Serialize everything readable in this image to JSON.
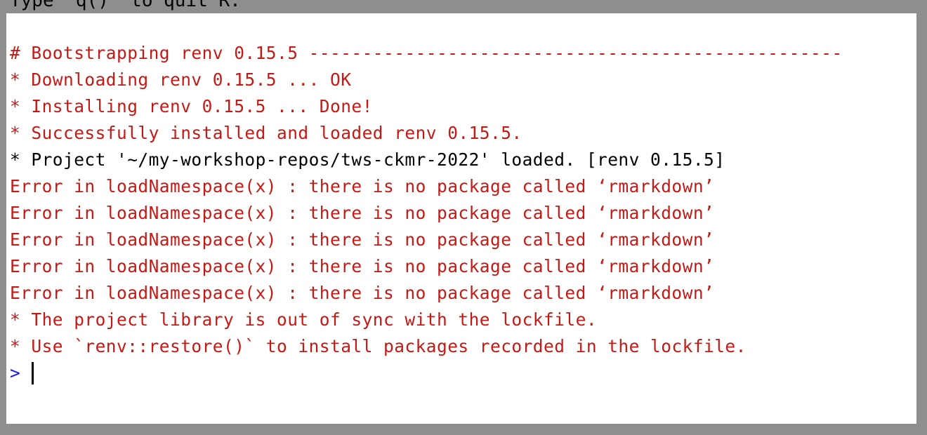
{
  "top_cutoff_text": "Type 'q()' to quit R.",
  "console": {
    "lines": [
      {
        "text": "# Bootstrapping renv 0.15.5 --------------------------------------------------",
        "color": "#c41a16"
      },
      {
        "text": "* Downloading renv 0.15.5 ... OK",
        "color": "#c41a16"
      },
      {
        "text": "* Installing renv 0.15.5 ... Done!",
        "color": "#c41a16"
      },
      {
        "text": "* Successfully installed and loaded renv 0.15.5.",
        "color": "#c41a16"
      },
      {
        "text": "* Project '~/my-workshop-repos/tws-ckmr-2022' loaded. [renv 0.15.5]",
        "color": "#000000"
      },
      {
        "text": "Error in loadNamespace(x) : there is no package called ‘rmarkdown’",
        "color": "#c41a16"
      },
      {
        "text": "Error in loadNamespace(x) : there is no package called ‘rmarkdown’",
        "color": "#c41a16"
      },
      {
        "text": "Error in loadNamespace(x) : there is no package called ‘rmarkdown’",
        "color": "#c41a16"
      },
      {
        "text": "Error in loadNamespace(x) : there is no package called ‘rmarkdown’",
        "color": "#c41a16"
      },
      {
        "text": "Error in loadNamespace(x) : there is no package called ‘rmarkdown’",
        "color": "#c41a16"
      },
      {
        "text": "* The project library is out of sync with the lockfile.",
        "color": "#c41a16"
      },
      {
        "text": "* Use `renv::restore()` to install packages recorded in the lockfile.",
        "color": "#c41a16"
      }
    ],
    "prompt": ">",
    "prompt_color": "#1a1ae6"
  }
}
